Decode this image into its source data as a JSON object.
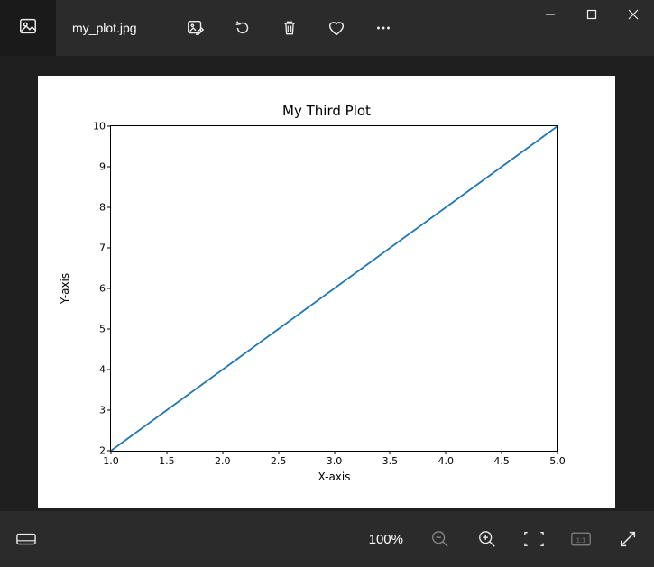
{
  "titlebar": {
    "filename": "my_plot.jpg"
  },
  "footer": {
    "zoom_label": "100%"
  },
  "chart_data": {
    "type": "line",
    "title": "My Third Plot",
    "xlabel": "X-axis",
    "ylabel": "Y-axis",
    "x": [
      1.0,
      5.0
    ],
    "y": [
      2,
      10
    ],
    "xlim": [
      1.0,
      5.0
    ],
    "ylim": [
      2,
      10
    ],
    "xticks": [
      "1.0",
      "1.5",
      "2.0",
      "2.5",
      "3.0",
      "3.5",
      "4.0",
      "4.5",
      "5.0"
    ],
    "yticks": [
      "2",
      "3",
      "4",
      "5",
      "6",
      "7",
      "8",
      "9",
      "10"
    ],
    "line_color": "#1f77b4"
  }
}
